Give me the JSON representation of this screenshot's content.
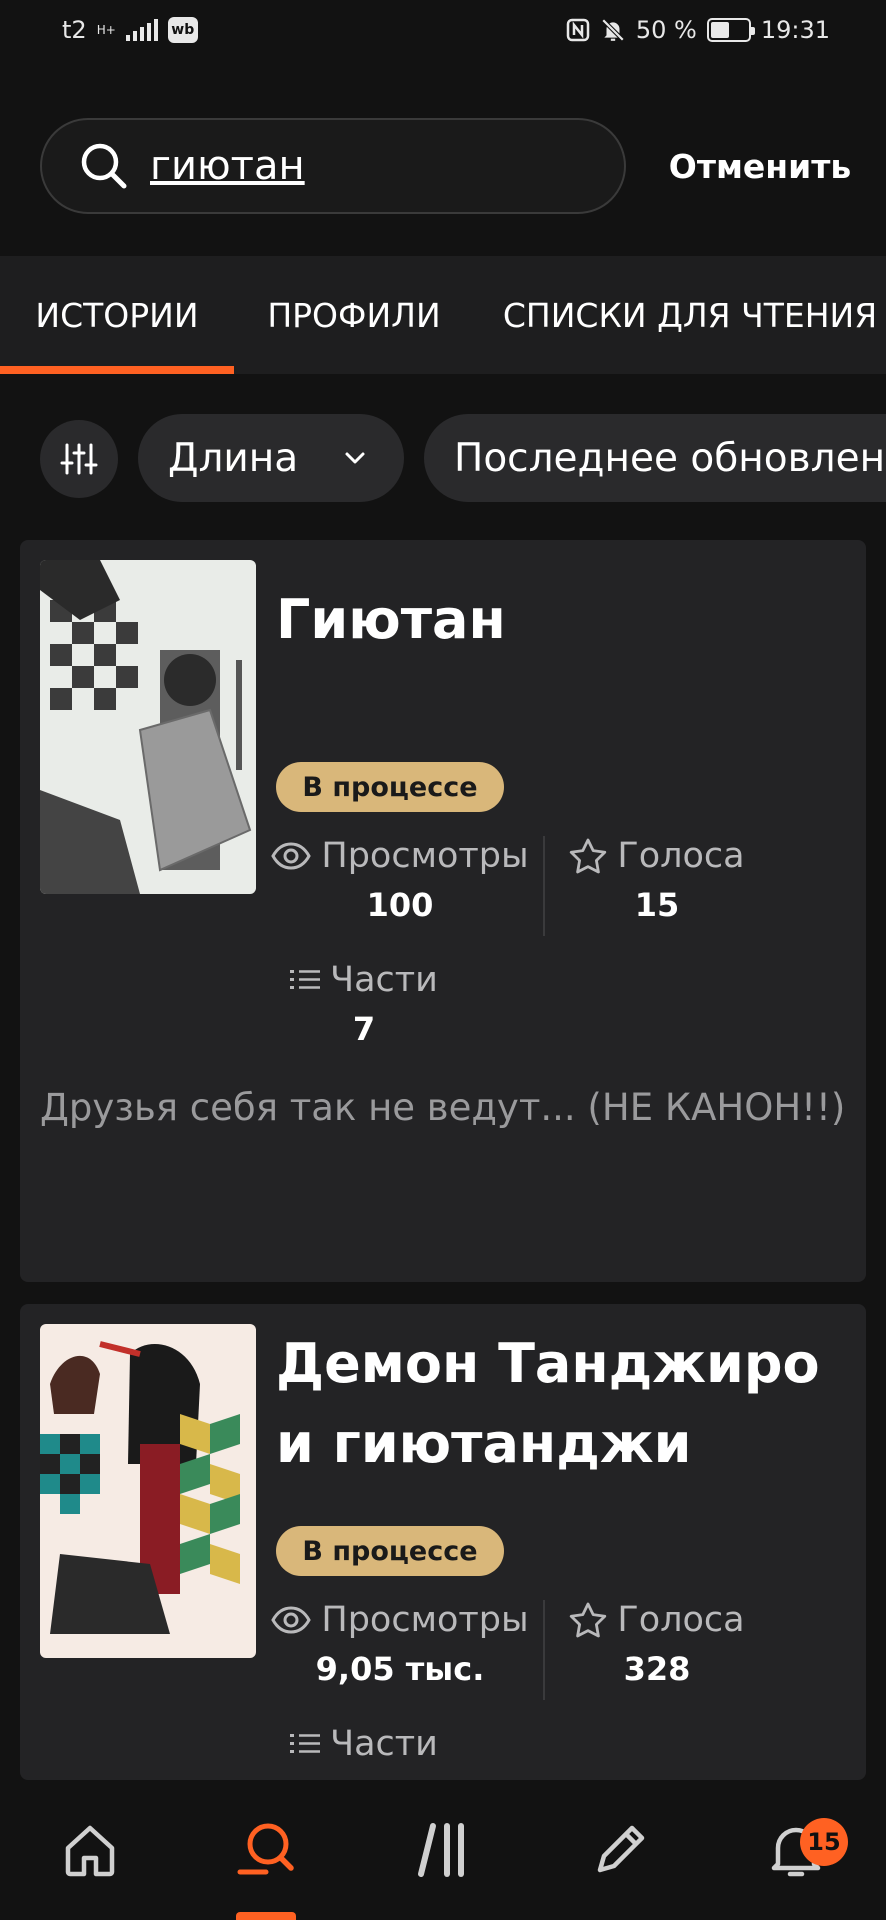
{
  "status_bar": {
    "carrier": "t2",
    "network": "H+",
    "app_badge": "wb",
    "battery": "50 %",
    "battery_level": 0.5,
    "time": "19:31"
  },
  "search": {
    "query": "гиютан",
    "cancel_label": "Отменить"
  },
  "tabs": [
    {
      "label": "ИСТОРИИ",
      "active": true
    },
    {
      "label": "ПРОФИЛИ",
      "active": false
    },
    {
      "label": "СПИСКИ ДЛЯ ЧТЕНИЯ",
      "active": false
    }
  ],
  "filters": {
    "length_label": "Длина",
    "updated_label": "Последнее обновлени"
  },
  "colors": {
    "accent": "#ff6122",
    "badge": "#d9b77a",
    "card": "#232325",
    "background": "#121212"
  },
  "stories": [
    {
      "title": "Гиютан",
      "status": "В процессе",
      "views_label": "Просмотры",
      "views": "100",
      "votes_label": "Голоса",
      "votes": "15",
      "parts_label": "Части",
      "parts": "7",
      "description": "Друзья себя так не ведут... (НЕ КАНОН!!)"
    },
    {
      "title": "Демон Танджиро и гиютанджи",
      "status": "В процессе",
      "views_label": "Просмотры",
      "views": "9,05 тыс.",
      "votes_label": "Голоса",
      "votes": "328",
      "parts_label": "Части"
    }
  ],
  "bottom_nav": {
    "items": [
      "home-icon",
      "search-icon",
      "library-icon",
      "write-icon",
      "notifications-icon"
    ],
    "notifications_count": "15"
  }
}
